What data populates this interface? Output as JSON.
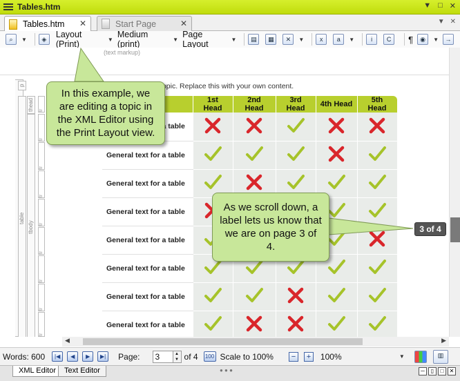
{
  "window": {
    "title": "Tables.htm",
    "controls": [
      "▼",
      "□",
      "✕"
    ]
  },
  "tabs": [
    {
      "label": "Tables.htm",
      "active": true
    },
    {
      "label": "Start Page",
      "active": false
    }
  ],
  "toolbar": {
    "layout_label": "Layout (Print)",
    "medium_label": "Medium (print)",
    "page_layout_label": "Page Layout",
    "markup_note": "(text markup)",
    "glyph_a": "a",
    "pilcrow": "¶"
  },
  "structure_bars": {
    "p": "p",
    "table": "table",
    "tbody": "tbody",
    "thead": "thead",
    "tr": "tr"
  },
  "content": {
    "intro": "General text for a topic. Replace this with your own content.",
    "headers": [
      "1st Head",
      "2nd Head",
      "3rd Head",
      "4th Head",
      "5th Head"
    ],
    "rows": [
      {
        "label": "General text for a table",
        "marks": [
          "x",
          "x",
          "check",
          "x",
          "x"
        ]
      },
      {
        "label": "General text for a table",
        "marks": [
          "check",
          "check",
          "check",
          "x",
          "check"
        ]
      },
      {
        "label": "General text for a table",
        "marks": [
          "check",
          "x",
          "check",
          "check",
          "check"
        ]
      },
      {
        "label": "General text for a table",
        "marks": [
          "x",
          "check",
          "check",
          "check",
          "check"
        ]
      },
      {
        "label": "General text for a table",
        "marks": [
          "check",
          "check",
          "check",
          "check",
          "x"
        ]
      },
      {
        "label": "General text for a table",
        "marks": [
          "check",
          "check",
          "check",
          "check",
          "check"
        ]
      },
      {
        "label": "General text for a table",
        "marks": [
          "check",
          "check",
          "x",
          "check",
          "check"
        ]
      },
      {
        "label": "General text for a table",
        "marks": [
          "check",
          "x",
          "x",
          "check",
          "check"
        ]
      }
    ]
  },
  "page_indicator": "3 of 4",
  "callouts": {
    "editor": "In this example, we are editing a topic in the XML Editor using the Print Layout view.",
    "scroll": "As we scroll down, a label lets us know that we are on page 3 of 4."
  },
  "statusbar": {
    "words": "Words: 600",
    "page_label": "Page:",
    "page_value": "3",
    "of_pages": "of 4",
    "scale_label": "Scale to 100%",
    "zoom_value": "100%"
  },
  "bottom_tabs": [
    "XML Editor",
    "Text Editor"
  ],
  "colors": {
    "accent": "#c0dc0c",
    "header_green": "#b8cf2e",
    "check": "#a6c32a",
    "cross": "#d9262b",
    "callout": "#c8e79a"
  }
}
